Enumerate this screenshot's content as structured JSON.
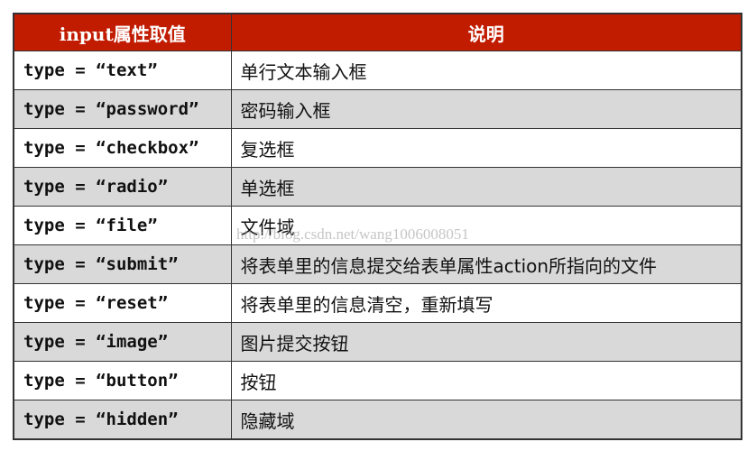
{
  "table": {
    "headers": [
      "input属性取值",
      "说明"
    ],
    "rows": [
      {
        "key": "type = “text”",
        "desc": "单行文本输入框"
      },
      {
        "key": "type = “password”",
        "desc": "密码输入框"
      },
      {
        "key": "type = “checkbox”",
        "desc": "复选框"
      },
      {
        "key": "type = “radio”",
        "desc": "单选框"
      },
      {
        "key": "type = “file”",
        "desc": "文件域"
      },
      {
        "key": "type = “submit”",
        "desc": "将表单里的信息提交给表单属性action所指向的文件"
      },
      {
        "key": "type = “reset”",
        "desc": "将表单里的信息清空，重新填写"
      },
      {
        "key": "type = “image”",
        "desc": "图片提交按钮"
      },
      {
        "key": "type = “button”",
        "desc": "按钮"
      },
      {
        "key": "type = “hidden”",
        "desc": "隐藏域"
      }
    ]
  },
  "watermark": "http://blog.csdn.net/wang1006008051",
  "colors": {
    "header_bg": "#c11b00",
    "alt_row_bg": "#d9d9d9"
  }
}
